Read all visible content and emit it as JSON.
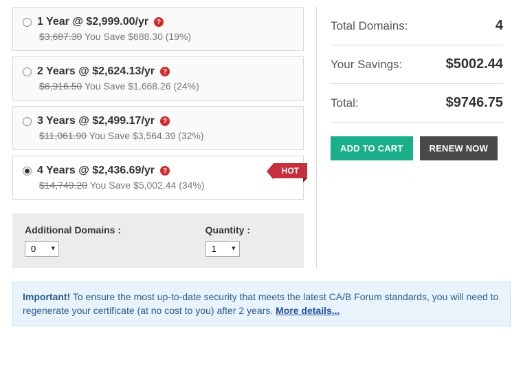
{
  "plans": [
    {
      "title": "1 Year @ $2,999.00/yr",
      "strike": "$3,687.30",
      "save": "You Save $688.30 (19%)",
      "selected": false,
      "hot": false
    },
    {
      "title": "2 Years @ $2,624.13/yr",
      "strike": "$6,916.50",
      "save": "You Save $1,668.26 (24%)",
      "selected": false,
      "hot": false
    },
    {
      "title": "3 Years @ $2,499.17/yr",
      "strike": "$11,061.90",
      "save": "You Save $3,564.39 (32%)",
      "selected": false,
      "hot": false
    },
    {
      "title": "4 Years @ $2,436.69/yr",
      "strike": "$14,749.20",
      "save": "You Save $5,002.44 (34%)",
      "selected": true,
      "hot": true
    }
  ],
  "hot_label": "HOT",
  "controls": {
    "domains_label": "Additional Domains :",
    "domains_value": "0",
    "quantity_label": "Quantity :",
    "quantity_value": "1"
  },
  "summary": {
    "domains_label": "Total Domains:",
    "domains_value": "4",
    "savings_label": "Your Savings:",
    "savings_value": "$5002.44",
    "total_label": "Total:",
    "total_value": "$9746.75"
  },
  "buttons": {
    "add": "ADD TO CART",
    "renew": "RENEW NOW"
  },
  "notice": {
    "prefix": "Important!",
    "body": " To ensure the most up-to-date security that meets the latest CA/B Forum standards, you will need to regenerate your certificate (at no cost to you) after 2 years. ",
    "link": "More details..."
  }
}
